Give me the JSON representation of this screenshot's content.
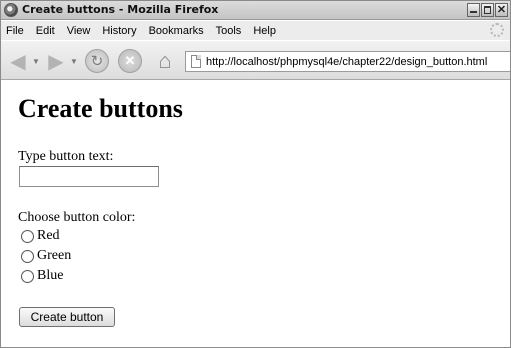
{
  "window": {
    "title": "Create buttons - Mozilla Firefox",
    "controls": {
      "close_glyph": "✕"
    }
  },
  "menu": {
    "items": [
      {
        "label": "File"
      },
      {
        "label": "Edit"
      },
      {
        "label": "View"
      },
      {
        "label": "History"
      },
      {
        "label": "Bookmarks"
      },
      {
        "label": "Tools"
      },
      {
        "label": "Help"
      }
    ]
  },
  "toolbar": {
    "url": "http://localhost/phpmysql4e/chapter22/design_button.html",
    "icons": [
      "back-arrow-icon",
      "dropdown-icon",
      "forward-arrow-icon",
      "dropdown-icon",
      "reload-icon",
      "stop-icon",
      "home-icon",
      "page-icon"
    ]
  },
  "page": {
    "heading": "Create buttons",
    "text_label": "Type button text:",
    "text_input": {
      "value": "",
      "placeholder": ""
    },
    "color_label": "Choose button color:",
    "color_options": [
      {
        "label": "Red",
        "checked": false
      },
      {
        "label": "Green",
        "checked": false
      },
      {
        "label": "Blue",
        "checked": false
      }
    ],
    "submit_label": "Create button"
  }
}
